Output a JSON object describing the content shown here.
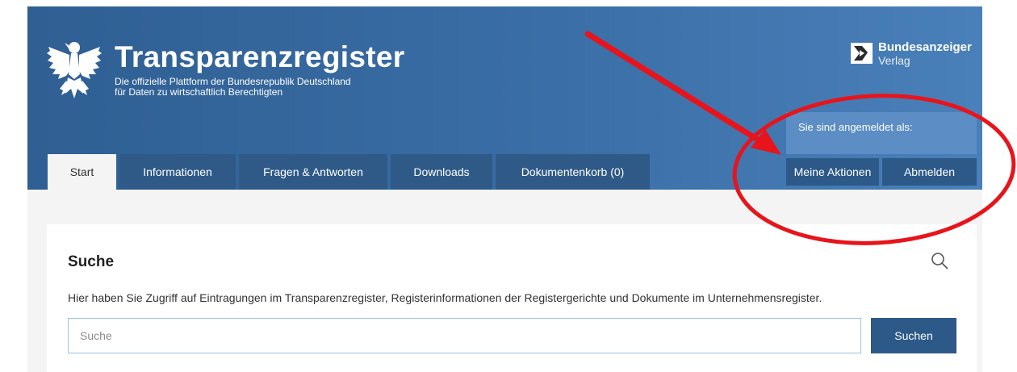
{
  "header": {
    "title": "Transparenzregister",
    "subtitle_line1": "Die offizielle Plattform der Bundesrepublik Deutschland",
    "subtitle_line2": "für Daten zu wirtschaftlich Berechtigten",
    "publisher_name": "Bundesanzeiger",
    "publisher_sub": "Verlag",
    "logged_in_label": "Sie sind angemeldet als:",
    "meine_aktionen_label": "Meine Aktionen",
    "abmelden_label": "Abmelden"
  },
  "nav": {
    "tabs": [
      {
        "label": "Start",
        "active": true
      },
      {
        "label": "Informationen",
        "active": false
      },
      {
        "label": "Fragen & Antworten",
        "active": false
      },
      {
        "label": "Downloads",
        "active": false
      },
      {
        "label": "Dokumentenkorb (0)",
        "active": false
      }
    ]
  },
  "search": {
    "title": "Suche",
    "description": "Hier haben Sie Zugriff auf Eintragungen im Transparenzregister, Registerinformationen der Registergerichte und Dokumente im Unternehmensregister.",
    "placeholder": "Suche",
    "value": "",
    "button_label": "Suchen"
  },
  "icons": {
    "eagle": "federal-eagle-icon",
    "publisher_logo": "bundesanzeiger-logo-icon",
    "search": "search-icon"
  },
  "colors": {
    "header_blue": "#3a6ea6",
    "button_blue": "#2c5988",
    "login_box": "#5c8dc4",
    "annotation_red": "#e8141b"
  }
}
